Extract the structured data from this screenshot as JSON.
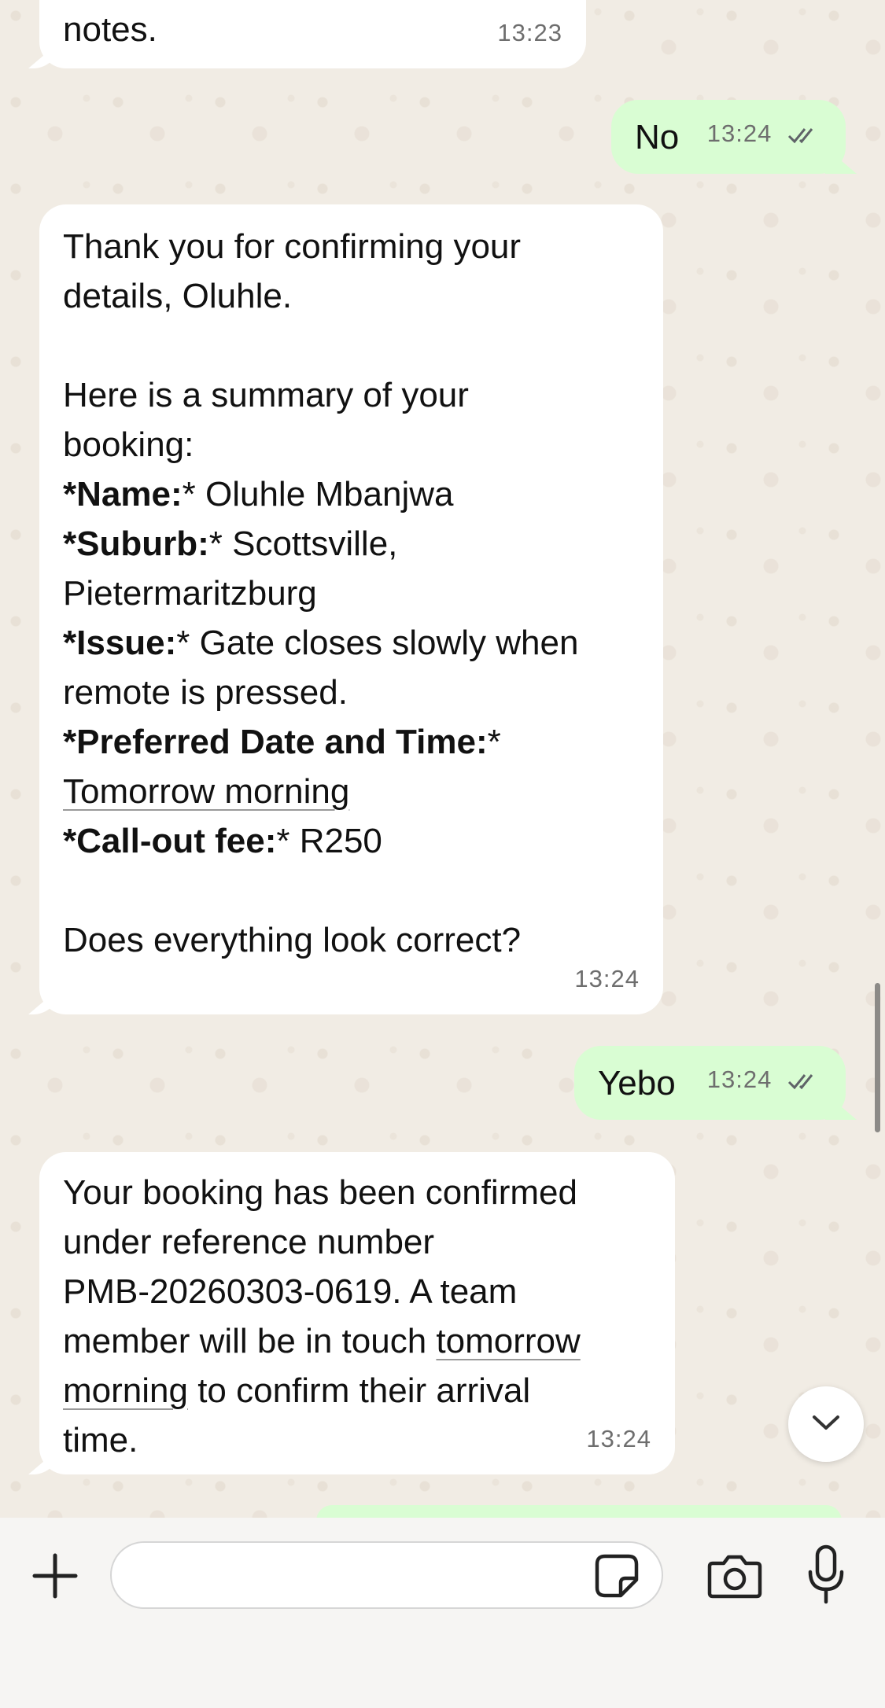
{
  "messages": [
    {
      "direction": "in",
      "text": "notes.",
      "time": "13:23"
    },
    {
      "direction": "out",
      "text": "No",
      "time": "13:24",
      "status": "read"
    },
    {
      "direction": "in",
      "time": "13:24",
      "line1": "Thank you for confirming your",
      "line2": "details, Oluhle.",
      "line3": "Here is a summary of your",
      "line4": "booking:",
      "name_label": "*Name:",
      "name_value": "* Oluhle Mbanjwa",
      "suburb_label": "*Suburb:",
      "suburb_value": "* Scottsville,",
      "suburb_value2": "Pietermaritzburg",
      "issue_label": "*Issue:",
      "issue_value": "* Gate closes slowly when",
      "issue_value2": "remote is pressed.",
      "date_label": "*Preferred Date and Time:",
      "date_star": "*",
      "date_value": "Tomorrow morning",
      "fee_label": "*Call-out fee:",
      "fee_value": "* R250",
      "question": "Does everything look correct?"
    },
    {
      "direction": "out",
      "text": "Yebo",
      "time": "13:24",
      "status": "read"
    },
    {
      "direction": "in",
      "time": "13:24",
      "l1": "Your booking has been confirmed",
      "l2": "under reference number",
      "l3": "PMB-20260303-0619. A team",
      "l4a": "member will be in touch ",
      "l4b": "tomorrow",
      "l5a": "morning",
      "l5b": " to confirm their arrival",
      "l6": "time."
    }
  ],
  "icons": {
    "read_receipt": "double-check-icon",
    "scroll_down": "chevron-down-icon",
    "attach": "plus-icon",
    "sticker": "sticker-icon",
    "camera": "camera-icon",
    "mic": "microphone-icon"
  },
  "composer": {
    "placeholder": ""
  },
  "colors": {
    "incoming": "#ffffff",
    "outgoing": "#d9fdd3",
    "wallpaper": "#f1ece4"
  }
}
